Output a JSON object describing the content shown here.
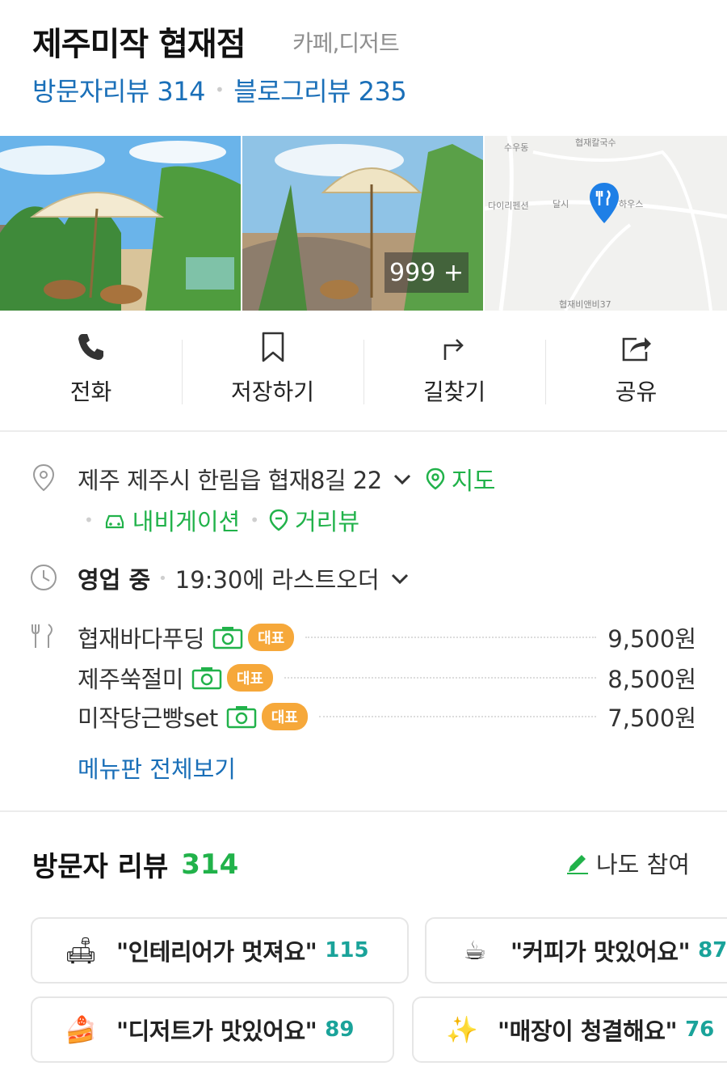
{
  "header": {
    "title": "제주미작 협재점",
    "category": "카페,디저트",
    "visitor_review_link": "방문자리뷰 314",
    "blog_review_link": "블로그리뷰 235"
  },
  "photos": {
    "more_count": "999 +",
    "map_labels": [
      "수우동",
      "협재칼국수",
      "다이리펜션",
      "달시",
      "하우스",
      "협재비앤비37"
    ]
  },
  "actions": [
    {
      "label": "전화",
      "icon": "phone-icon"
    },
    {
      "label": "저장하기",
      "icon": "bookmark-icon"
    },
    {
      "label": "길찾기",
      "icon": "directions-icon"
    },
    {
      "label": "공유",
      "icon": "share-icon"
    }
  ],
  "info": {
    "address": "제주 제주시 한림읍 협재8길 22",
    "map_link": "지도",
    "navigation": "내비게이션",
    "street_view": "거리뷰",
    "status": "영업 중",
    "last_order": "19:30에 라스트오더"
  },
  "menu": {
    "items": [
      {
        "name": "협재바다푸딩",
        "badge": "대표",
        "price": "9,500원"
      },
      {
        "name": "제주쑥절미",
        "badge": "대표",
        "price": "8,500원"
      },
      {
        "name": "미작당근빵set",
        "badge": "대표",
        "price": "7,500원"
      }
    ],
    "view_all": "메뉴판 전체보기"
  },
  "reviews": {
    "title": "방문자 리뷰",
    "count": "314",
    "join": "나도 참여",
    "keywords": [
      {
        "emoji": "🛋",
        "text": "\"인테리어가 멋져요\"",
        "count": "115"
      },
      {
        "emoji": "☕",
        "text": "\"커피가 맛있어요\"",
        "count": "87"
      },
      {
        "emoji": "🍰",
        "text": "\"디저트가 맛있어요\"",
        "count": "89"
      },
      {
        "emoji": "✨",
        "text": "\"매장이 청결해요\"",
        "count": "76"
      }
    ]
  },
  "colors": {
    "green": "#21b24a",
    "link_blue": "#1a6fb8",
    "badge_orange": "#f6a83a",
    "keyword_count": "#1aa39a"
  }
}
